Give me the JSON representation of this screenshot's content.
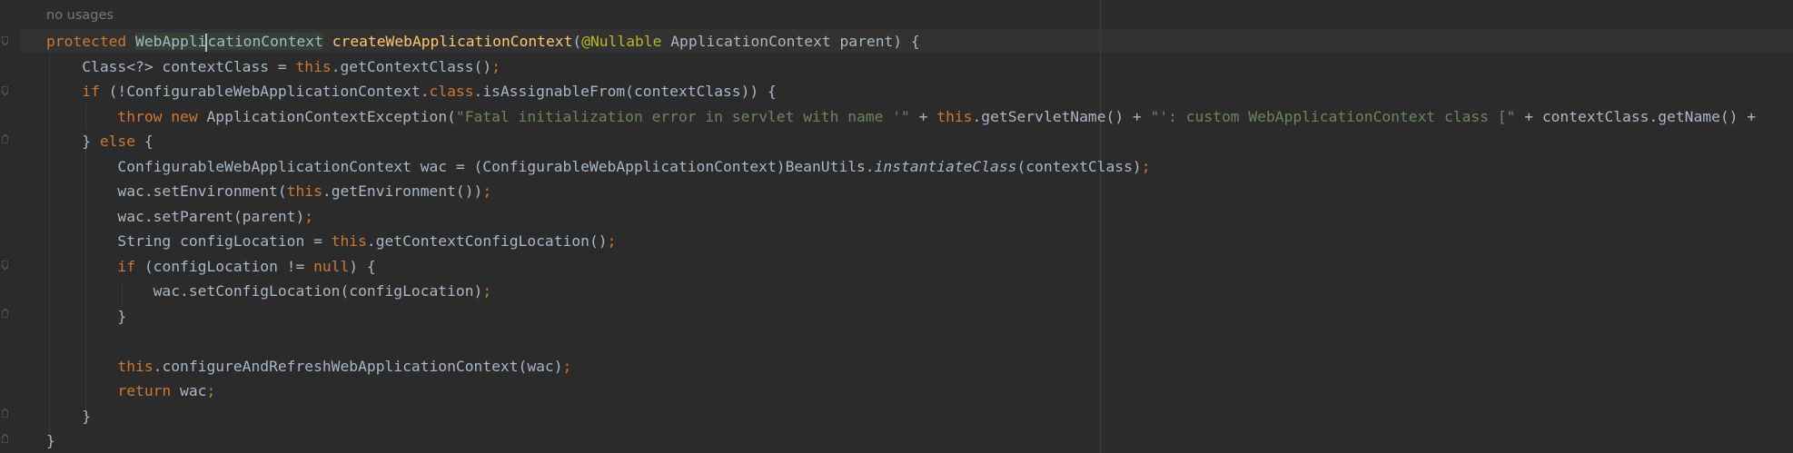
{
  "editor": {
    "language": "java",
    "usage_hint": "no usages",
    "lines": [
      {
        "tokens": [
          {
            "t": "protected",
            "c": "kw"
          },
          {
            "t": " "
          },
          {
            "t": "WebApplicationContext",
            "c": "hl"
          },
          {
            "t": " "
          },
          {
            "t": "createWebApplicationContext",
            "c": "fn"
          },
          {
            "t": "("
          },
          {
            "t": "@Nullable",
            "c": "ann"
          },
          {
            "t": " ApplicationContext parent) {"
          }
        ]
      },
      {
        "tokens": [
          {
            "t": "    Class<?> contextClass = "
          },
          {
            "t": "this",
            "c": "kw"
          },
          {
            "t": ".getContextClass()"
          },
          {
            "t": ";",
            "c": "kw"
          }
        ]
      },
      {
        "tokens": [
          {
            "t": "    "
          },
          {
            "t": "if",
            "c": "kw"
          },
          {
            "t": " (!ConfigurableWebApplicationContext."
          },
          {
            "t": "class",
            "c": "kw"
          },
          {
            "t": ".isAssignableFrom(contextClass)) {"
          }
        ]
      },
      {
        "tokens": [
          {
            "t": "        "
          },
          {
            "t": "throw new",
            "c": "kw"
          },
          {
            "t": " ApplicationContextException("
          },
          {
            "t": "\"Fatal initialization error in servlet with name '\"",
            "c": "str"
          },
          {
            "t": " + "
          },
          {
            "t": "this",
            "c": "kw"
          },
          {
            "t": ".getServletName() + "
          },
          {
            "t": "\"': custom WebApplicationContext class [\"",
            "c": "str"
          },
          {
            "t": " + contextClass.getName() +"
          }
        ]
      },
      {
        "tokens": [
          {
            "t": "    } "
          },
          {
            "t": "else",
            "c": "kw"
          },
          {
            "t": " {"
          }
        ]
      },
      {
        "tokens": [
          {
            "t": "        ConfigurableWebApplicationContext wac = (ConfigurableWebApplicationContext)BeanUtils."
          },
          {
            "t": "instantiateClass",
            "c": "it"
          },
          {
            "t": "(contextClass)"
          },
          {
            "t": ";",
            "c": "kw"
          }
        ]
      },
      {
        "tokens": [
          {
            "t": "        wac.setEnvironment("
          },
          {
            "t": "this",
            "c": "kw"
          },
          {
            "t": ".getEnvironment())"
          },
          {
            "t": ";",
            "c": "kw"
          }
        ]
      },
      {
        "tokens": [
          {
            "t": "        wac.setParent(parent)"
          },
          {
            "t": ";",
            "c": "kw"
          }
        ]
      },
      {
        "tokens": [
          {
            "t": "        String configLocation = "
          },
          {
            "t": "this",
            "c": "kw"
          },
          {
            "t": ".getContextConfigLocation()"
          },
          {
            "t": ";",
            "c": "kw"
          }
        ]
      },
      {
        "tokens": [
          {
            "t": "        "
          },
          {
            "t": "if",
            "c": "kw"
          },
          {
            "t": " (configLocation != "
          },
          {
            "t": "null",
            "c": "kw"
          },
          {
            "t": ") {"
          }
        ]
      },
      {
        "tokens": [
          {
            "t": "            wac.setConfigLocation(configLocation)"
          },
          {
            "t": ";",
            "c": "kw"
          }
        ]
      },
      {
        "tokens": [
          {
            "t": "        }"
          }
        ]
      },
      {
        "tokens": []
      },
      {
        "tokens": [
          {
            "t": "        "
          },
          {
            "t": "this",
            "c": "kw"
          },
          {
            "t": ".configureAndRefreshWebApplicationContext(wac)"
          },
          {
            "t": ";",
            "c": "kw"
          }
        ]
      },
      {
        "tokens": [
          {
            "t": "        "
          },
          {
            "t": "return",
            "c": "kw"
          },
          {
            "t": " wac"
          },
          {
            "t": ";",
            "c": "kw"
          }
        ]
      },
      {
        "tokens": [
          {
            "t": "    }"
          }
        ]
      },
      {
        "tokens": [
          {
            "t": "}"
          }
        ]
      }
    ]
  }
}
